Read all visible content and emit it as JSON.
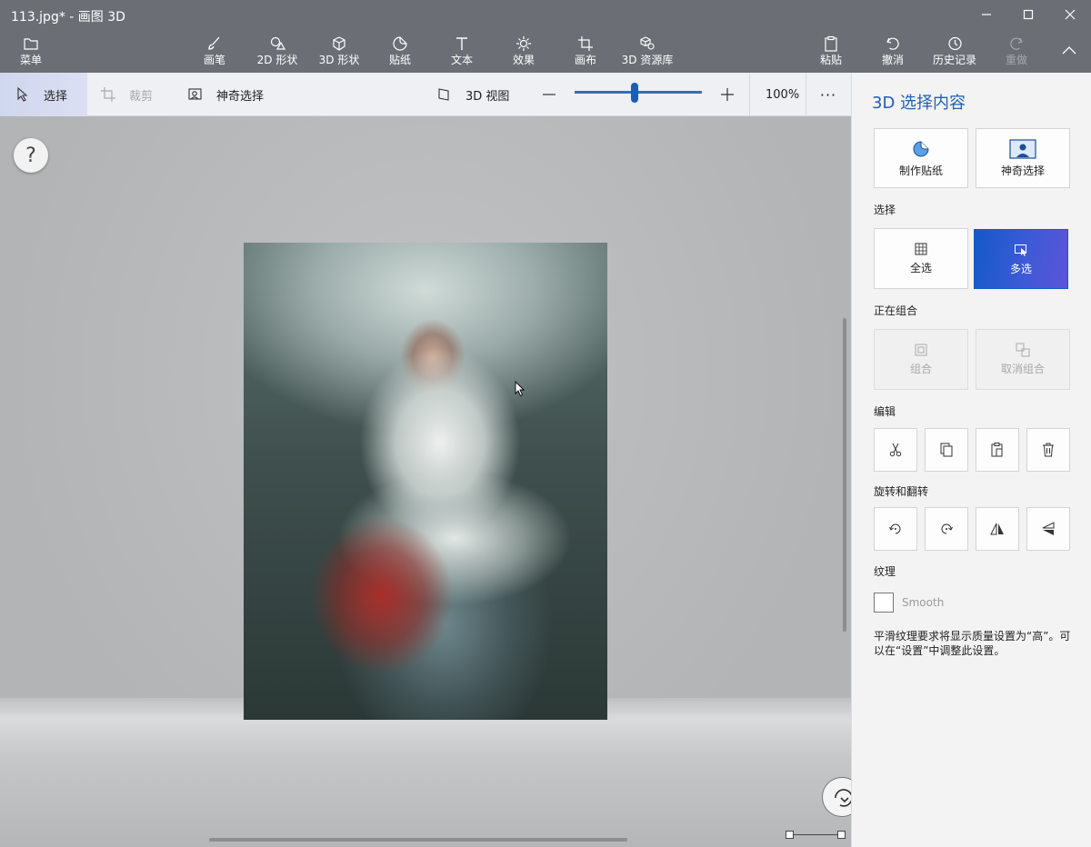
{
  "window": {
    "title": "113.jpg* - 画图 3D"
  },
  "ribbon": {
    "menu": "菜单",
    "tools": [
      "画笔",
      "2D 形状",
      "3D 形状",
      "贴纸",
      "文本",
      "效果",
      "画布",
      "3D 资源库"
    ],
    "paste": "粘贴",
    "undo": "撤消",
    "history": "历史记录",
    "redo": "重做"
  },
  "toolbar": {
    "select": "选择",
    "crop": "裁剪",
    "magic_select": "神奇选择",
    "view_3d": "3D 视图",
    "zoom_percent": 0.47,
    "zoom": "100%",
    "more": "···"
  },
  "canvas": {
    "help": "?"
  },
  "panel": {
    "title": "3D 选择内容",
    "make_sticker": "制作贴纸",
    "magic_select": "神奇选择",
    "select_section": "选择",
    "select_all": "全选",
    "multi_select": "多选",
    "grouping_section": "正在组合",
    "group": "组合",
    "ungroup": "取消组合",
    "edit_section": "编辑",
    "rotate_section": "旋转和翻转",
    "texture_section": "纹理",
    "smooth": "Smooth",
    "note": "平滑纹理要求将显示质量设置为“高”。可以在“设置”中调整此设置。"
  },
  "colors": {
    "accent": "#1f5fb5",
    "active_start": "#1459c8",
    "active_end": "#5b54d8",
    "chrome": "#6b6f75"
  }
}
